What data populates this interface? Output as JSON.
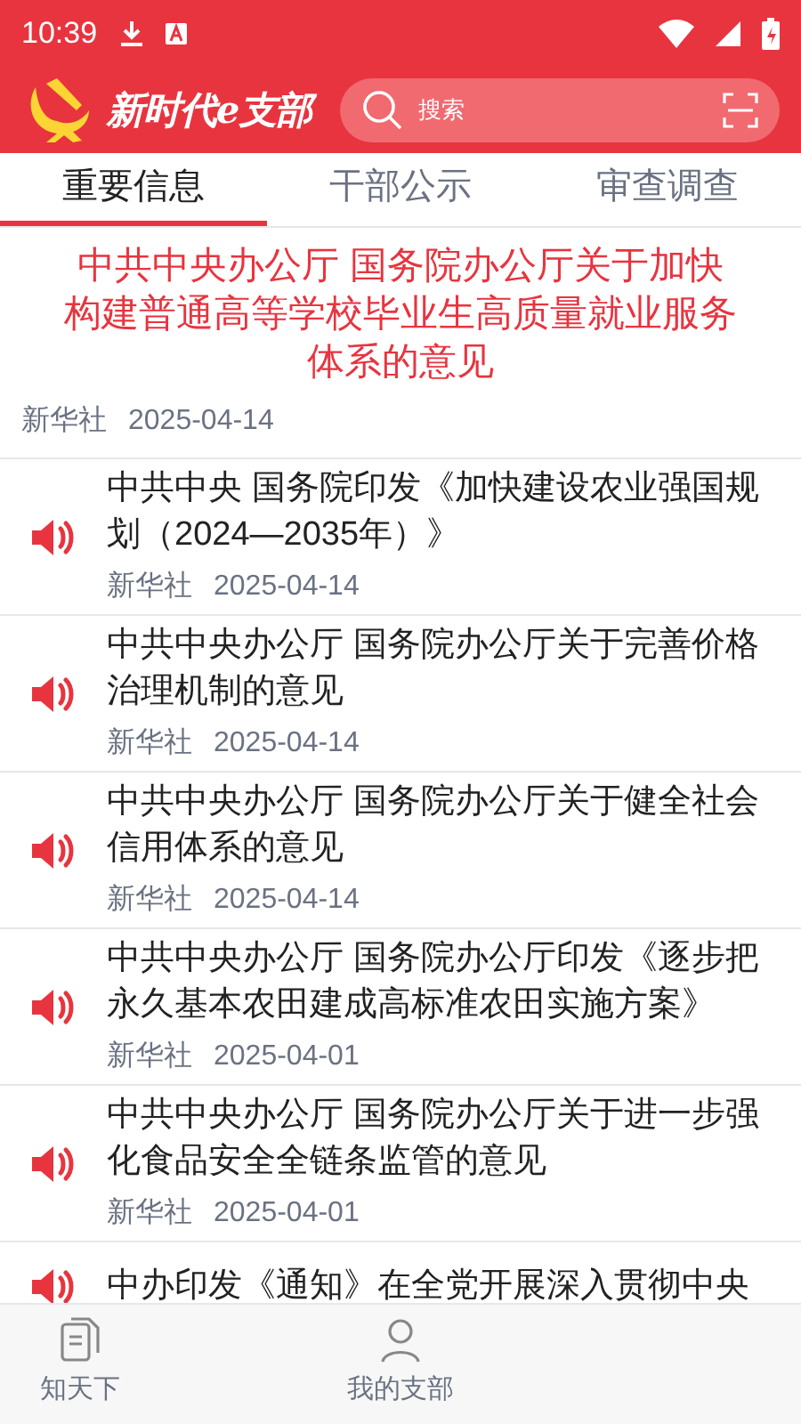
{
  "status_bar": {
    "time": "10:39"
  },
  "header": {
    "app_title": "新时代e支部",
    "search": {
      "placeholder": "搜索"
    }
  },
  "tabs": [
    {
      "label": "重要信息",
      "selected": true
    },
    {
      "label": "干部公示",
      "selected": false
    },
    {
      "label": "审查调查",
      "selected": false
    }
  ],
  "featured": {
    "title": "中共中央办公厅 国务院办公厅关于加快构建普通高等学校毕业生高质量就业服务体系的意见",
    "source": "新华社",
    "date": "2025-04-14"
  },
  "articles": [
    {
      "title": "中共中央 国务院印发《加快建设农业强国规划（2024—2035年）》",
      "source": "新华社",
      "date": "2025-04-14"
    },
    {
      "title": "中共中央办公厅 国务院办公厅关于完善价格治理机制的意见",
      "source": "新华社",
      "date": "2025-04-14"
    },
    {
      "title": "中共中央办公厅 国务院办公厅关于健全社会信用体系的意见",
      "source": "新华社",
      "date": "2025-04-14"
    },
    {
      "title": "中共中央办公厅 国务院办公厅印发《逐步把永久基本农田建成高标准农田实施方案》",
      "source": "新华社",
      "date": "2025-04-01"
    },
    {
      "title": "中共中央办公厅 国务院办公厅关于进一步强化食品安全全链条监管的意见",
      "source": "新华社",
      "date": "2025-04-01"
    },
    {
      "title": "中办印发《通知》在全党开展深入贯彻中央"
    }
  ],
  "bottom_nav": [
    {
      "label": "知天下"
    },
    {
      "label": "我的支部"
    }
  ]
}
